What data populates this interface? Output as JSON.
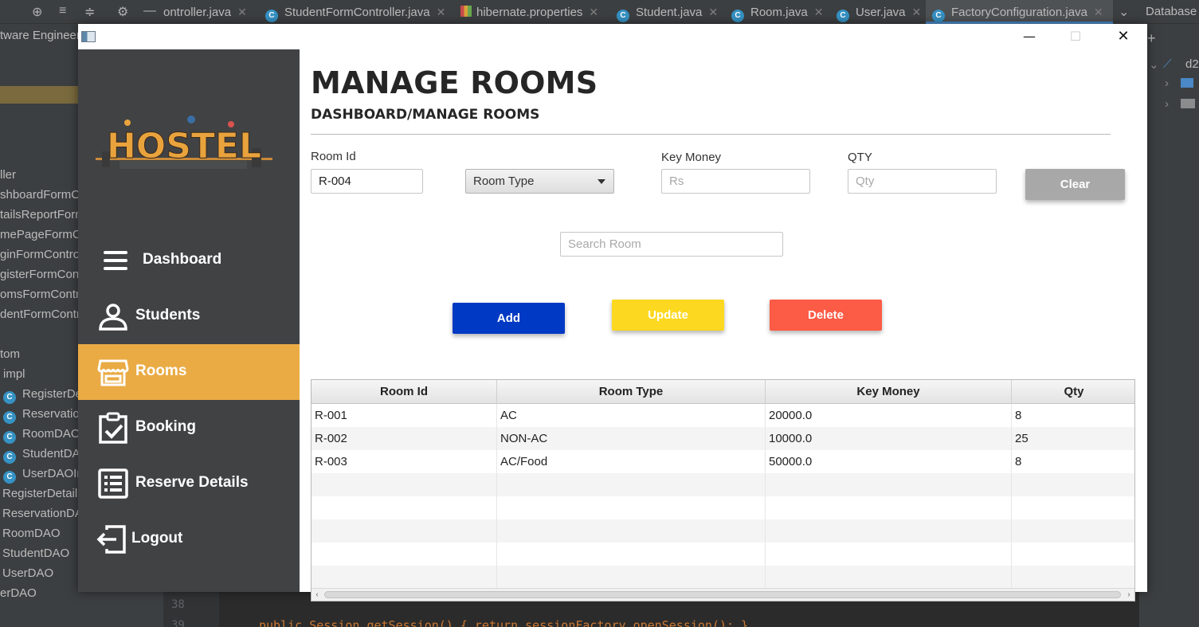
{
  "ide": {
    "tabs": [
      {
        "label": "ontroller.java"
      },
      {
        "label": "StudentFormController.java"
      },
      {
        "label": "hibernate.properties"
      },
      {
        "label": "Student.java"
      },
      {
        "label": "Room.java"
      },
      {
        "label": "User.java"
      },
      {
        "label": "FactoryConfiguration.java"
      }
    ],
    "right_label": "Database",
    "right_tree": [
      "d2"
    ],
    "tree_title": "tware Engineer",
    "tree_items": [
      "ller",
      "shboardFormCo",
      "tailsReportForm",
      "mePageFormCo",
      "ginFormControl",
      "gisterFormCont",
      "omsFormContro",
      "dentFormContro",
      "tom",
      "impl",
      "RegisterDe",
      "Reservation",
      "RoomDAO",
      "StudentDA",
      "UserDAOIn",
      "RegisterDetail",
      "ReservationDA",
      "RoomDAO",
      "StudentDAO",
      "UserDAO",
      "erDAO"
    ],
    "gutter": [
      "38",
      "39"
    ],
    "code": "public Session getSession() { return sessionFactory.openSession(); }"
  },
  "app": {
    "title_buttons": {
      "minimize": "—",
      "maximize": "☐",
      "close": "✕"
    },
    "logo_text": "HOSTEL",
    "nav": [
      {
        "label": "Dashboard",
        "icon": "menu-icon"
      },
      {
        "label": "Students",
        "icon": "user-icon"
      },
      {
        "label": "Rooms",
        "icon": "store-icon"
      },
      {
        "label": "Booking",
        "icon": "clipboard-check-icon"
      },
      {
        "label": "Reserve Details",
        "icon": "list-icon"
      },
      {
        "label": "Logout",
        "icon": "logout-icon"
      }
    ],
    "active_nav": "Rooms",
    "colors": {
      "sidebar": "#414244",
      "active": "#eaab45",
      "add": "#0039c4",
      "update": "#fdd821",
      "delete": "#fc5b45",
      "clear": "#a8a8a8"
    }
  },
  "page": {
    "title": "MANAGE ROOMS",
    "breadcrumb": "DASHBOARD/MANAGE ROOMS"
  },
  "form": {
    "room_id_label": "Room Id",
    "room_id_value": "R-004",
    "room_type_selected": "Room Type",
    "key_money_label": "Key Money",
    "key_money_placeholder": "Rs",
    "qty_label": "QTY",
    "qty_placeholder": "Qty",
    "clear_label": "Clear",
    "search_placeholder": "Search Room",
    "add_label": "Add",
    "update_label": "Update",
    "delete_label": "Delete"
  },
  "table": {
    "columns": [
      "Room Id",
      "Room Type",
      "Key Money",
      "Qty"
    ],
    "rows": [
      [
        "R-001",
        "AC",
        "20000.0",
        "8"
      ],
      [
        "R-002",
        "NON-AC",
        "10000.0",
        "25"
      ],
      [
        "R-003",
        "AC/Food",
        "50000.0",
        "8"
      ]
    ],
    "empty_rows": 5
  }
}
